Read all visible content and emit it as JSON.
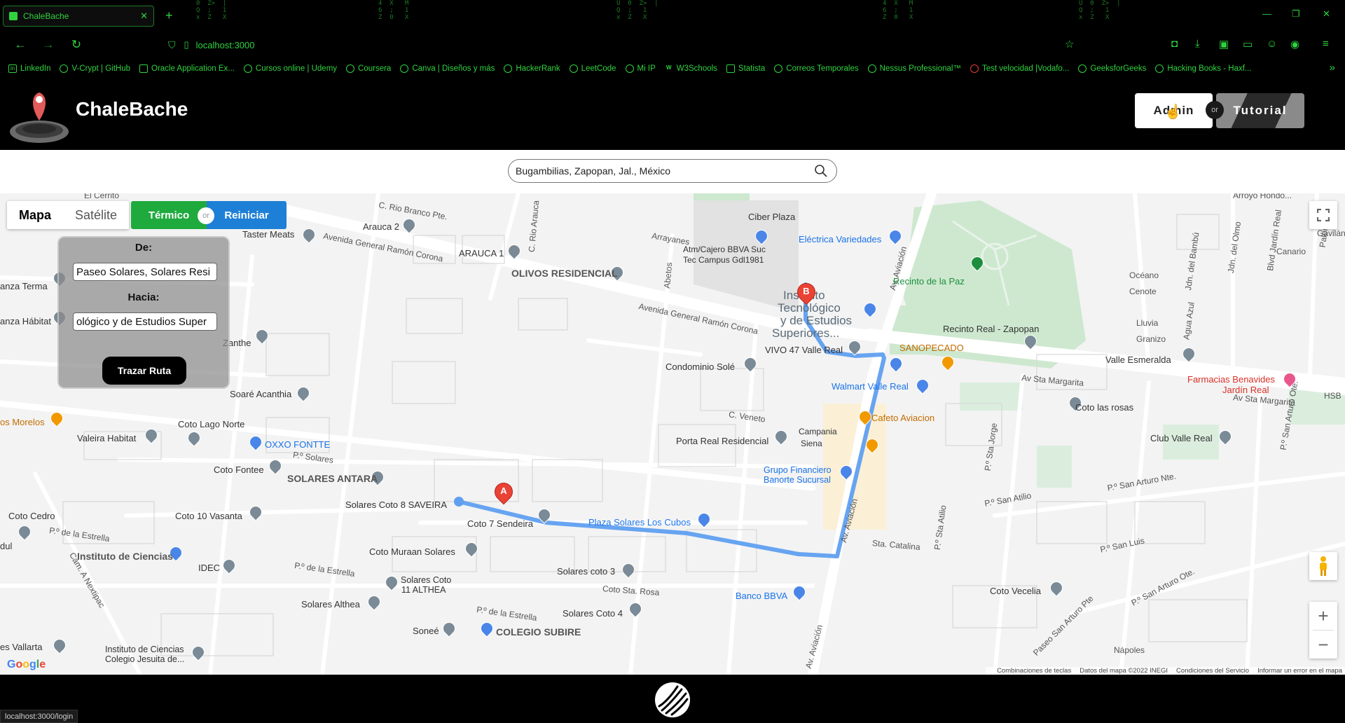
{
  "browser": {
    "tab_title": "ChaleBache",
    "url": "localhost:3000",
    "status_url": "localhost:3000/login",
    "bookmarks": [
      "LinkedIn",
      "V-Crypt | GitHub",
      "Oracle Application Ex...",
      "Cursos online | Udemy",
      "Coursera",
      "Canva | Diseños y más",
      "HackerRank",
      "LeetCode",
      "Mi IP",
      "W3Schools",
      "Statista",
      "Correos Temporales",
      "Nessus Professional™",
      "Test velocidad |Vodafo...",
      "GeeksforGeeks",
      "Hacking Books - Haxf..."
    ],
    "accent_color": "#2fd33e"
  },
  "header": {
    "brand": "ChaleBache",
    "admin_label": "Admin",
    "or_label": "or",
    "tutorial_label": "Tutorial"
  },
  "search": {
    "value": "Bugambilias, Zapopan, Jal., México"
  },
  "map_controls": {
    "map_label": "Mapa",
    "satellite_label": "Satélite",
    "termico_label": "Térmico",
    "or_label": "or",
    "reiniciar_label": "Reiniciar",
    "termico_color": "#1faa3e",
    "reiniciar_color": "#1e7fd6"
  },
  "route_panel": {
    "from_label": "De:",
    "from_value": "Paseo Solares, Solares Resi",
    "to_label": "Hacia:",
    "to_value": "ológico y de Estudios Super",
    "button_label": "Trazar Ruta"
  },
  "markers": {
    "a": "A",
    "b": "B"
  },
  "map_labels": {
    "ciber_plaza": "Ciber Plaza",
    "arauca2": "Arauca 2",
    "taster": "Taster Meats",
    "arauca1": "ARAUCA 1",
    "rio_branco": "C. Rio Branco Pte.",
    "rio_arauca": "C. Rio Arauca",
    "av_ramon1": "Avenida General Ramón Corona",
    "av_ramon2": "Avenida General Ramón Corona",
    "arrayanes": "Arrayanes",
    "abetos": "Abetos",
    "atm": "Atm/Cajero BBVA Suc",
    "atm2": "Tec Campus Gdl1981",
    "electrica": "Eléctrica Variedades",
    "olivos": "OLIVOS RESIDENCIAL",
    "instituto1": "Instituto",
    "instituto2": "Tecnológico",
    "instituto3": "y de Estudios",
    "instituto4": "Superiores...",
    "recinto_paz": "Recinto de la Paz",
    "recinto_real": "Recinto Real - Zapopan",
    "vivo47": "VIVO 47 Valle Real",
    "sanopecado": "SANOPECADO",
    "condominio": "Condominio Solé",
    "walmart": "Walmart Valle Real",
    "av_sta_margarita": "Av Sta Margarita",
    "av_sta_margarita2": "Av Sta Margarita",
    "valle_esmeralda": "Valle Esmeralda",
    "farmacias": "Farmacias Benavides",
    "farmacias2": "Jardín Real",
    "cafeto": "Cafeto Aviacion",
    "c_veneto": "C. Veneto",
    "campania": "Campania",
    "siena": "Siena",
    "porta_real": "Porta Real Residencial",
    "grupo": "Grupo Financiero",
    "banorte": "Banorte Sucursal",
    "coto_rosas": "Coto las rosas",
    "club_valle": "Club Valle Real",
    "soare": "Soaré Acanthia",
    "zanthe": "Zanthe",
    "anza_terma": "anza Terma",
    "anza_habitat": "anza Hábitat",
    "coto_lago": "Coto Lago Norte",
    "valeira": "Valeira Habitat",
    "oxxo": "OXXO FONTTE",
    "os_morelos": "os Morelos",
    "coto_fontee": "Coto Fontee",
    "solares_antara": "SOLARES ANTARA",
    "p_solares": "P.º Solares",
    "solares_saveira": "Solares Coto 8 SAVEIRA",
    "coto7": "Coto 7 Sendeira",
    "plaza_cubos": "Plaza Solares Los Cubos",
    "coto_cedro": "Coto Cedro",
    "coto10": "Coto 10 Vasanta",
    "p_estrella": "P.º de la Estrella",
    "p_estrella2": "P.º de la Estrella",
    "p_estrella3": "P.º de la Estrella",
    "instituto_ciencias": "Instituto de Ciencias",
    "idec": "IDEC",
    "coto_muraan": "Coto Muraan Solares",
    "solares_coto11": "Solares Coto",
    "solares_coto11b": "11 ALTHEA",
    "solares_althea": "Solares Althea",
    "solares_coto3": "Solares coto 3",
    "coto_sta_rosa": "Coto Sta. Rosa",
    "solares_coto4": "Solares Coto 4",
    "sonee": "Soneé",
    "colegio_subire": "COLEGIO SUBIRE",
    "banco_bbva": "Banco BBVA",
    "sta_catalina": "Sta. Catalina",
    "av_aviacion1": "Av. Aviación",
    "av_aviacion2": "Av. Aviación",
    "av_aviacion3": "Av. Aviación",
    "cam_nextipac": "Cam. A Nextipac",
    "vallarta": "es Vallarta",
    "instituto_colegio": "Instituto de Ciencias",
    "instituto_colegio2": "Colegio Jesuita de...",
    "dul": "dul",
    "gavilan": "Gavilán",
    "canario": "Canario",
    "oceano": "Océano",
    "cenote": "Cenote",
    "lluvia": "Lluvia",
    "granizo": "Granizo",
    "blvd_jardin": "Blvd Jardín Real",
    "jdn_olmo": "Jdn. del Olmo",
    "jdn_bambu": "Jdn. del Bambú",
    "agua_azul": "Agua Azul",
    "paloma": "Paloma",
    "hsb": "HSB",
    "p_sta_jorge": "P.º Sta Jorge",
    "p_san_atilio": "P.º San Atilio",
    "p_sta_atilio": "P.º Sta Atilio",
    "p_san_arturo": "P.º San Arturo Nte.",
    "p_san_arturo_ote": "P.º San Arturo Ote.",
    "p_san_arturo_ote2": "P.º San Arturo Ote.",
    "p_san_luis": "P.º San Luis",
    "coto_vecelia": "Coto Vecelia",
    "paseo_san_arturo": "Paseo San Arturo Pte",
    "napoles": "Nápoles",
    "el_cerrito": "El Cerrito",
    "arroyo": "Arroyo Hondo..."
  },
  "google": {
    "logo": "Google",
    "keyboard": "Combinaciones de teclas",
    "map_data": "Datos del mapa ©2022 INEGI",
    "terms": "Condiciones del Servicio",
    "report": "Informar un error en el mapa"
  }
}
